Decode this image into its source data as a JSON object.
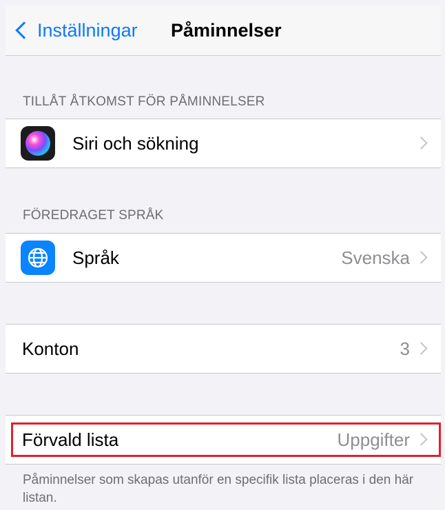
{
  "navbar": {
    "back_label": "Inställningar",
    "title": "Påminnelser"
  },
  "sections": [
    {
      "header": "TILLÅT ÅTKOMST FÖR PÅMINNELSER",
      "row": {
        "label": "Siri och sökning",
        "value": "",
        "icon": "siri-icon"
      }
    },
    {
      "header": "FÖREDRAGET SPRÅK",
      "row": {
        "label": "Språk",
        "value": "Svenska",
        "icon": "globe-icon"
      }
    },
    {
      "header": "",
      "row": {
        "label": "Konton",
        "value": "3"
      }
    },
    {
      "header": "",
      "row": {
        "label": "Förvald lista",
        "value": "Uppgifter"
      },
      "footer": "Påminnelser som skapas utanför en specifik lista placeras i den här listan."
    }
  ],
  "colors": {
    "accent": "#0a7aff",
    "highlight": "#e0202e",
    "background": "#f2f2f7"
  }
}
